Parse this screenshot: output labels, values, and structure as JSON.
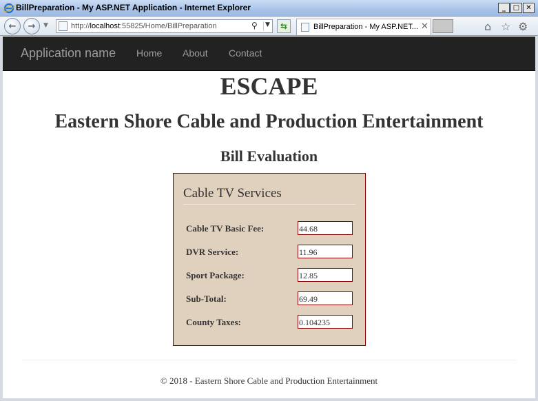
{
  "window": {
    "title": "BillPreparation - My ASP.NET Application - Internet Explorer",
    "minimize": "_",
    "maximize": "□",
    "close": "✕"
  },
  "browser": {
    "address_prefix": "http://",
    "address_host": "localhost",
    "address_rest": ":55825/Home/BillPreparation",
    "tab_title": "BillPreparation - My ASP.NET...",
    "tab_close": "✕"
  },
  "site_nav": {
    "brand": "Application name",
    "links": [
      "Home",
      "About",
      "Contact"
    ]
  },
  "headings": {
    "main": "ESCAPE",
    "company": "Eastern Shore Cable and Production Entertainment",
    "section": "Bill Evaluation"
  },
  "form": {
    "legend": "Cable TV Services",
    "fields": [
      {
        "label": "Cable TV Basic Fee:",
        "value": "44.68"
      },
      {
        "label": "DVR Service:",
        "value": "11.96"
      },
      {
        "label": "Sport Package:",
        "value": "12.85"
      },
      {
        "label": "Sub-Total:",
        "value": "69.49"
      },
      {
        "label": "County Taxes:",
        "value": "0.104235"
      }
    ]
  },
  "footer": {
    "text": "© 2018 - Eastern Shore Cable and Production Entertainment"
  },
  "colors": {
    "navbar_bg": "#222222",
    "panel_bg": "#e0d1be",
    "panel_border": "#8b0000"
  },
  "icons": [
    "ie-logo-icon",
    "back-icon",
    "forward-icon",
    "page-icon",
    "search-icon",
    "refresh-icon",
    "home-icon",
    "favorites-star-icon",
    "settings-gear-icon"
  ]
}
